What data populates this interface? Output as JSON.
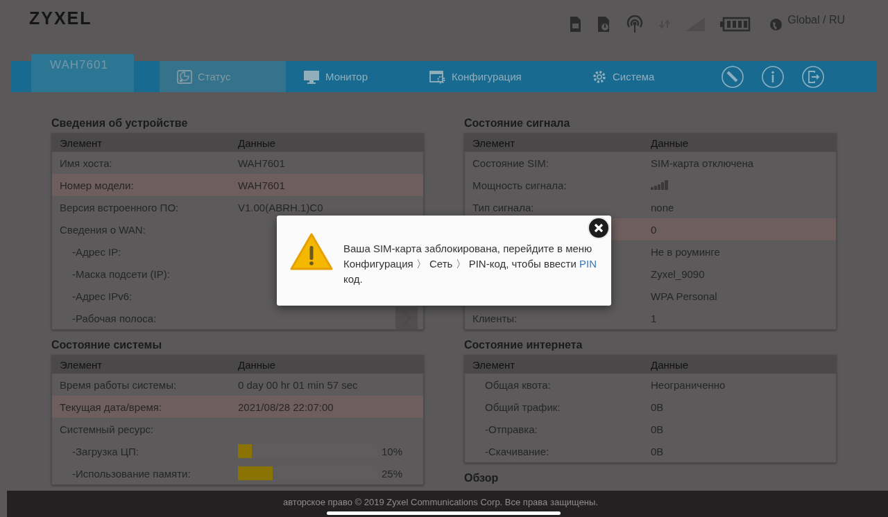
{
  "header": {
    "logo": "ZYXEL",
    "language": "Global / RU"
  },
  "nav": {
    "device": "WAH7601",
    "tabs": [
      {
        "label": "Статус",
        "kind": "status",
        "selected": true
      },
      {
        "label": "Монитор",
        "kind": "monitor",
        "selected": false
      },
      {
        "label": "Конфигурация",
        "kind": "config",
        "selected": false
      },
      {
        "label": "Система",
        "kind": "system",
        "selected": false
      }
    ]
  },
  "left_column": [
    {
      "title": "Сведения об устройстве",
      "columns": [
        "Элемент",
        "Данные"
      ],
      "rows": [
        {
          "label": "Имя хоста:",
          "value": "WAH7601",
          "kind": "text",
          "highlighted": false
        },
        {
          "label": "Номер модели:",
          "value": "WAH7601",
          "kind": "text",
          "highlighted": true
        },
        {
          "label": "Версия встроенного ПО:",
          "value": "V1.00(ABRH.1)C0",
          "kind": "text",
          "highlighted": false
        },
        {
          "label": "Сведения о WAN:",
          "kind": "text",
          "highlighted": false,
          "children": [
            {
              "label": "-Адрес IP:",
              "kind": "text",
              "highlighted": false
            },
            {
              "label": "-Маска подсети (IP):",
              "kind": "text",
              "highlighted": false
            },
            {
              "label": "-Адрес IPv6:",
              "kind": "text",
              "highlighted": false
            },
            {
              "label": "-Рабочая полоса:",
              "kind": "text",
              "highlighted": false,
              "more_button": true
            }
          ]
        }
      ]
    },
    {
      "title": "Состояние системы",
      "columns": [
        "Элемент",
        "Данные"
      ],
      "rows": [
        {
          "label": "Время работы системы:",
          "value": "0 day 00 hr 01 min 57 sec",
          "kind": "text",
          "highlighted": false
        },
        {
          "label": "Текущая дата/время:",
          "value": "2021/08/28 22:07:00",
          "kind": "text",
          "highlighted": true
        },
        {
          "label": "Системный ресурс:",
          "kind": "text",
          "highlighted": false,
          "children": [
            {
              "label": "-Загрузка ЦП:",
              "kind": "meter",
              "level": 0.1,
              "reading": "10%",
              "highlighted": false
            },
            {
              "label": "-Использование памяти:",
              "kind": "meter",
              "level": 0.25,
              "reading": "25%",
              "highlighted": false
            }
          ]
        }
      ]
    }
  ],
  "right_column": [
    {
      "title": "Состояние сигнала",
      "columns": [
        "Элемент",
        "Данные"
      ],
      "rows": [
        {
          "label": "Состояние SIM:",
          "value": "SIM-карта отключена",
          "kind": "text",
          "highlighted": false
        },
        {
          "label": "Мощность сигнала:",
          "kind": "signal",
          "highlighted": false
        },
        {
          "label": "Тип сигнала:",
          "value": "none",
          "kind": "text",
          "highlighted": false
        },
        {
          "value": "0",
          "kind": "text",
          "highlighted": true
        },
        {
          "value": "Не в роуминге",
          "kind": "text",
          "highlighted": false
        },
        {
          "value": "Zyxel_9090",
          "kind": "text",
          "highlighted": false
        },
        {
          "value": "WPA Personal",
          "kind": "text",
          "highlighted": false
        },
        {
          "label": "Клиенты:",
          "value": "1",
          "kind": "text",
          "highlighted": false
        }
      ]
    },
    {
      "title": "Состояние интернета",
      "columns": [
        "Элемент",
        "Данные"
      ],
      "rows": [
        {
          "label": "Общая квота:",
          "value": "Неограниченно",
          "kind": "text",
          "indented": true,
          "highlighted": false
        },
        {
          "label": "Общий трафик:",
          "value": "0B",
          "kind": "text",
          "indented": true,
          "highlighted": false
        },
        {
          "label": "-Отправка:",
          "value": "0B",
          "kind": "text",
          "indented": true,
          "highlighted": false
        },
        {
          "label": "-Скачивание:",
          "value": "0B",
          "kind": "text",
          "indented": true,
          "highlighted": false
        }
      ]
    },
    {
      "title": "Обзор"
    }
  ],
  "dialog": {
    "before": "Ваша SIM-карта заблокирована, перейдите в меню Конфигурация 〉 Сеть 〉 PIN-код, чтобы ввести",
    "link": "PIN",
    "after": "код."
  },
  "footer": {
    "text": "авторское право © 2019 Zyxel Communications Corp. Все права защищены."
  }
}
